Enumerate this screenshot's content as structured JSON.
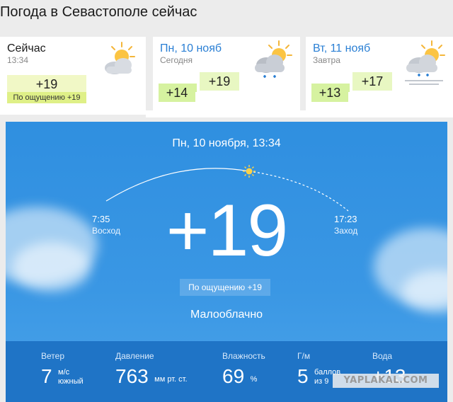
{
  "page": {
    "title": "Погода в Севастополе сейчас"
  },
  "now": {
    "title": "Сейчас",
    "time": "13:34",
    "temp": "+19",
    "feels": "По ощущению +19",
    "icon": "partly-cloudy-icon"
  },
  "forecast": [
    {
      "title": "Пн, 10 нояб",
      "sub": "Сегодня",
      "min": "+14",
      "max": "+19",
      "icon": "cloud-sun-rain-icon"
    },
    {
      "title": "Вт, 11 нояб",
      "sub": "Завтра",
      "min": "+13",
      "max": "+17",
      "icon": "cloud-sun-rain-fog-icon"
    }
  ],
  "main": {
    "date": "Пн, 10 ноября, 13:34",
    "sunrise_time": "7:35",
    "sunrise_label": "Восход",
    "sunset_time": "17:23",
    "sunset_label": "Заход",
    "temp": "+19",
    "feels": "По ощущению +19",
    "condition": "Малооблачно"
  },
  "stats": {
    "wind": {
      "label": "Ветер",
      "value": "7",
      "unit1": "м/с",
      "unit2": "южный"
    },
    "pressure": {
      "label": "Давление",
      "value": "763",
      "unit": "мм рт. ст."
    },
    "humidity": {
      "label": "Влажность",
      "value": "69",
      "unit": "%"
    },
    "geomag": {
      "label": "Г/м",
      "value": "5",
      "unit1": "баллов",
      "unit2": "из 9"
    },
    "water": {
      "label": "Вода",
      "value": "+13"
    }
  },
  "watermark": "YAPLAKAL.COM",
  "colors": {
    "accent": "#2a7fd4",
    "panel": "#3a97e4",
    "stats_bar": "#1f74c6",
    "temp_box": "#dff087"
  }
}
